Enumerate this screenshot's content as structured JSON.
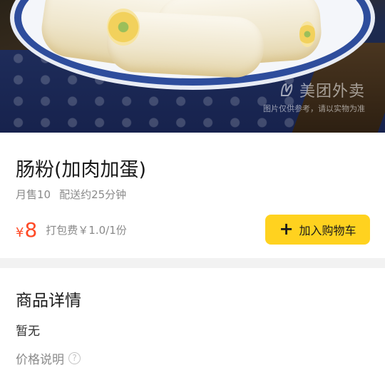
{
  "hero": {
    "image_alt": "肠粉(加肉加蛋)",
    "watermark_brand": "美团外卖",
    "watermark_note": "图片仅供参考，请以实物为准"
  },
  "product": {
    "name": "肠粉(加肉加蛋)",
    "monthly_sales": "月售10",
    "delivery_time": "配送约25分钟",
    "price_symbol": "¥",
    "price": "8",
    "packing_fee": "打包费￥1.0/1份"
  },
  "actions": {
    "add_to_cart_icon": "plus-icon",
    "add_to_cart_label": "加入购物车"
  },
  "details": {
    "title": "商品详情",
    "text": "暂无",
    "price_note_label": "价格说明",
    "help_icon": "question-circle-icon",
    "help_glyph": "?"
  },
  "colors": {
    "price": "#ff4a26",
    "cart_button": "#ffd21f",
    "divider": "#f2f2f2"
  }
}
